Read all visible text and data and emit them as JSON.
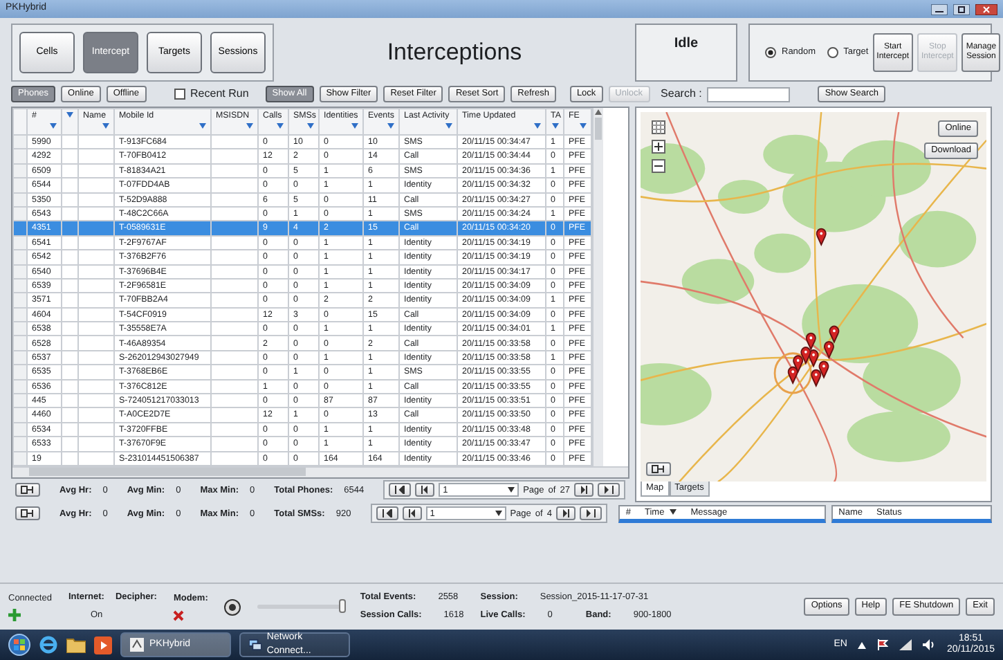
{
  "window": {
    "title": "PKHybrid"
  },
  "nav_tabs": [
    {
      "label": "Cells",
      "selected": false
    },
    {
      "label": "Intercept",
      "selected": true
    },
    {
      "label": "Targets",
      "selected": false
    },
    {
      "label": "Sessions",
      "selected": false
    }
  ],
  "heading": "Interceptions",
  "status": "Idle",
  "mode_options": [
    {
      "label": "Random",
      "selected": true
    },
    {
      "label": "Target",
      "selected": false
    }
  ],
  "intercept_buttons": [
    {
      "label": "Start Intercept",
      "disabled": false
    },
    {
      "label": "Stop Intercept",
      "disabled": true
    },
    {
      "label": "Manage Session",
      "disabled": false
    }
  ],
  "filters": [
    {
      "label": "Phones",
      "selected": true
    },
    {
      "label": "Online",
      "selected": false
    },
    {
      "label": "Offline",
      "selected": false
    }
  ],
  "recent_run": {
    "label": "Recent Run",
    "checked": false
  },
  "toolbar_buttons": [
    {
      "label": "Show All",
      "pressed": true,
      "disabled": false
    },
    {
      "label": "Show Filter",
      "pressed": false,
      "disabled": false
    },
    {
      "label": "Reset Filter",
      "pressed": false,
      "disabled": false
    },
    {
      "label": "Reset Sort",
      "pressed": false,
      "disabled": false
    },
    {
      "label": "Refresh",
      "pressed": false,
      "disabled": false
    },
    {
      "label": "Lock",
      "pressed": false,
      "disabled": false
    },
    {
      "label": "Unlock",
      "pressed": false,
      "disabled": true
    }
  ],
  "search": {
    "label": "Search :"
  },
  "show_search": "Show Search",
  "table": {
    "columns": [
      {
        "label": "#",
        "kind": "text"
      },
      {
        "kind": "filter"
      },
      {
        "label": "Name",
        "kind": "text"
      },
      {
        "label": "Mobile Id",
        "kind": "text"
      },
      {
        "label": "MSISDN",
        "kind": "text"
      },
      {
        "label": "Calls",
        "kind": "text"
      },
      {
        "label": "SMSs",
        "kind": "text"
      },
      {
        "label": "Identities",
        "kind": "text"
      },
      {
        "label": "Events",
        "kind": "text"
      },
      {
        "label": "Last Activity",
        "kind": "text"
      },
      {
        "label": "Time Updated",
        "kind": "text"
      },
      {
        "label": "TA",
        "kind": "text"
      },
      {
        "label": "FE",
        "kind": "text"
      }
    ],
    "rows": [
      {
        "id": "5990",
        "mobile_id": "T-913FC684",
        "calls": "0",
        "smss": "10",
        "identities": "0",
        "events": "10",
        "last_activity": "SMS",
        "time_updated": "20/11/15 00:34:47",
        "ta": "1",
        "fe": "PFE",
        "selected": false
      },
      {
        "id": "4292",
        "mobile_id": "T-70FB0412",
        "calls": "12",
        "smss": "2",
        "identities": "0",
        "events": "14",
        "last_activity": "Call",
        "time_updated": "20/11/15 00:34:44",
        "ta": "0",
        "fe": "PFE",
        "selected": false
      },
      {
        "id": "6509",
        "mobile_id": "T-81834A21",
        "calls": "0",
        "smss": "5",
        "identities": "1",
        "events": "6",
        "last_activity": "SMS",
        "time_updated": "20/11/15 00:34:36",
        "ta": "1",
        "fe": "PFE",
        "selected": false
      },
      {
        "id": "6544",
        "mobile_id": "T-07FDD4AB",
        "calls": "0",
        "smss": "0",
        "identities": "1",
        "events": "1",
        "last_activity": "Identity",
        "time_updated": "20/11/15 00:34:32",
        "ta": "0",
        "fe": "PFE",
        "selected": false
      },
      {
        "id": "5350",
        "mobile_id": "T-52D9A888",
        "calls": "6",
        "smss": "5",
        "identities": "0",
        "events": "11",
        "last_activity": "Call",
        "time_updated": "20/11/15 00:34:27",
        "ta": "0",
        "fe": "PFE",
        "selected": false
      },
      {
        "id": "6543",
        "mobile_id": "T-48C2C66A",
        "calls": "0",
        "smss": "1",
        "identities": "0",
        "events": "1",
        "last_activity": "SMS",
        "time_updated": "20/11/15 00:34:24",
        "ta": "1",
        "fe": "PFE",
        "selected": false
      },
      {
        "id": "4351",
        "mobile_id": "T-0589631E",
        "calls": "9",
        "smss": "4",
        "identities": "2",
        "events": "15",
        "last_activity": "Call",
        "time_updated": "20/11/15 00:34:20",
        "ta": "0",
        "fe": "PFE",
        "selected": true
      },
      {
        "id": "6541",
        "mobile_id": "T-2F9767AF",
        "calls": "0",
        "smss": "0",
        "identities": "1",
        "events": "1",
        "last_activity": "Identity",
        "time_updated": "20/11/15 00:34:19",
        "ta": "0",
        "fe": "PFE",
        "selected": false
      },
      {
        "id": "6542",
        "mobile_id": "T-376B2F76",
        "calls": "0",
        "smss": "0",
        "identities": "1",
        "events": "1",
        "last_activity": "Identity",
        "time_updated": "20/11/15 00:34:19",
        "ta": "0",
        "fe": "PFE",
        "selected": false
      },
      {
        "id": "6540",
        "mobile_id": "T-37696B4E",
        "calls": "0",
        "smss": "0",
        "identities": "1",
        "events": "1",
        "last_activity": "Identity",
        "time_updated": "20/11/15 00:34:17",
        "ta": "0",
        "fe": "PFE",
        "selected": false
      },
      {
        "id": "6539",
        "mobile_id": "T-2F96581E",
        "calls": "0",
        "smss": "0",
        "identities": "1",
        "events": "1",
        "last_activity": "Identity",
        "time_updated": "20/11/15 00:34:09",
        "ta": "0",
        "fe": "PFE",
        "selected": false
      },
      {
        "id": "3571",
        "mobile_id": "T-70FBB2A4",
        "calls": "0",
        "smss": "0",
        "identities": "2",
        "events": "2",
        "last_activity": "Identity",
        "time_updated": "20/11/15 00:34:09",
        "ta": "1",
        "fe": "PFE",
        "selected": false
      },
      {
        "id": "4604",
        "mobile_id": "T-54CF0919",
        "calls": "12",
        "smss": "3",
        "identities": "0",
        "events": "15",
        "last_activity": "Call",
        "time_updated": "20/11/15 00:34:09",
        "ta": "0",
        "fe": "PFE",
        "selected": false
      },
      {
        "id": "6538",
        "mobile_id": "T-35558E7A",
        "calls": "0",
        "smss": "0",
        "identities": "1",
        "events": "1",
        "last_activity": "Identity",
        "time_updated": "20/11/15 00:34:01",
        "ta": "1",
        "fe": "PFE",
        "selected": false
      },
      {
        "id": "6528",
        "mobile_id": "T-46A89354",
        "calls": "2",
        "smss": "0",
        "identities": "0",
        "events": "2",
        "last_activity": "Call",
        "time_updated": "20/11/15 00:33:58",
        "ta": "0",
        "fe": "PFE",
        "selected": false
      },
      {
        "id": "6537",
        "mobile_id": "S-262012943027949",
        "calls": "0",
        "smss": "0",
        "identities": "1",
        "events": "1",
        "last_activity": "Identity",
        "time_updated": "20/11/15 00:33:58",
        "ta": "1",
        "fe": "PFE",
        "selected": false
      },
      {
        "id": "6535",
        "mobile_id": "T-3768EB6E",
        "calls": "0",
        "smss": "1",
        "identities": "0",
        "events": "1",
        "last_activity": "SMS",
        "time_updated": "20/11/15 00:33:55",
        "ta": "0",
        "fe": "PFE",
        "selected": false
      },
      {
        "id": "6536",
        "mobile_id": "T-376C812E",
        "calls": "1",
        "smss": "0",
        "identities": "0",
        "events": "1",
        "last_activity": "Call",
        "time_updated": "20/11/15 00:33:55",
        "ta": "0",
        "fe": "PFE",
        "selected": false
      },
      {
        "id": "445",
        "mobile_id": "S-724051217033013",
        "calls": "0",
        "smss": "0",
        "identities": "87",
        "events": "87",
        "last_activity": "Identity",
        "time_updated": "20/11/15 00:33:51",
        "ta": "0",
        "fe": "PFE",
        "selected": false
      },
      {
        "id": "4460",
        "mobile_id": "T-A0CE2D7E",
        "calls": "12",
        "smss": "1",
        "identities": "0",
        "events": "13",
        "last_activity": "Call",
        "time_updated": "20/11/15 00:33:50",
        "ta": "0",
        "fe": "PFE",
        "selected": false
      },
      {
        "id": "6534",
        "mobile_id": "T-3720FFBE",
        "calls": "0",
        "smss": "0",
        "identities": "1",
        "events": "1",
        "last_activity": "Identity",
        "time_updated": "20/11/15 00:33:48",
        "ta": "0",
        "fe": "PFE",
        "selected": false
      },
      {
        "id": "6533",
        "mobile_id": "T-37670F9E",
        "calls": "0",
        "smss": "0",
        "identities": "1",
        "events": "1",
        "last_activity": "Identity",
        "time_updated": "20/11/15 00:33:47",
        "ta": "0",
        "fe": "PFE",
        "selected": false
      },
      {
        "id": "19",
        "mobile_id": "S-231014451506387",
        "calls": "0",
        "smss": "0",
        "identities": "164",
        "events": "164",
        "last_activity": "Identity",
        "time_updated": "20/11/15 00:33:46",
        "ta": "0",
        "fe": "PFE",
        "selected": false
      }
    ]
  },
  "phones_pager": {
    "stats": [
      {
        "label": "Avg Hr:",
        "value": "0"
      },
      {
        "label": "Avg Min:",
        "value": "0"
      },
      {
        "label": "Max Min:",
        "value": "0"
      },
      {
        "label": "Total Phones:",
        "value": "6544"
      }
    ],
    "page": "1",
    "page_label": "Page",
    "of_label": "of",
    "total_pages": "27"
  },
  "map": {
    "buttons": [
      "Online",
      "Download"
    ],
    "tabs": [
      {
        "label": "Map",
        "selected": true
      },
      {
        "label": "Targets",
        "selected": false
      }
    ]
  },
  "sms_pager": {
    "stats": [
      {
        "label": "Avg Hr:",
        "value": "0"
      },
      {
        "label": "Avg Min:",
        "value": "0"
      },
      {
        "label": "Max Min:",
        "value": "0"
      },
      {
        "label": "Total SMSs:",
        "value": "920"
      }
    ],
    "page": "1",
    "page_label": "Page",
    "of_label": "of",
    "total_pages": "4"
  },
  "event_list": {
    "columns": [
      "#",
      "Time",
      "Message"
    ]
  },
  "target_list": {
    "columns": [
      "Name",
      "Status"
    ]
  },
  "status_bar": {
    "connection": "Connected",
    "internet_label": "Internet:",
    "internet_value": "On",
    "decipher_label": "Decipher:",
    "modem_label": "Modem:",
    "volume": {
      "level": 1
    },
    "fields": [
      {
        "label": "Total Events:",
        "value": "2558"
      },
      {
        "label": "Session Calls:",
        "value": "1618"
      },
      {
        "label": "Session:",
        "value": "Session_2015-11-17-07-31"
      },
      {
        "label": "Live Calls:",
        "value": "0"
      },
      {
        "label": "Band:",
        "value": "900-1800"
      }
    ],
    "buttons": [
      "Options",
      "Help",
      "FE Shutdown",
      "Exit"
    ]
  },
  "taskbar": {
    "tasks": [
      {
        "label": "PKHybrid",
        "active": true
      },
      {
        "label": "Network Connect...",
        "active": false
      }
    ],
    "language": "EN",
    "time": "18:51",
    "date": "20/11/2015"
  }
}
